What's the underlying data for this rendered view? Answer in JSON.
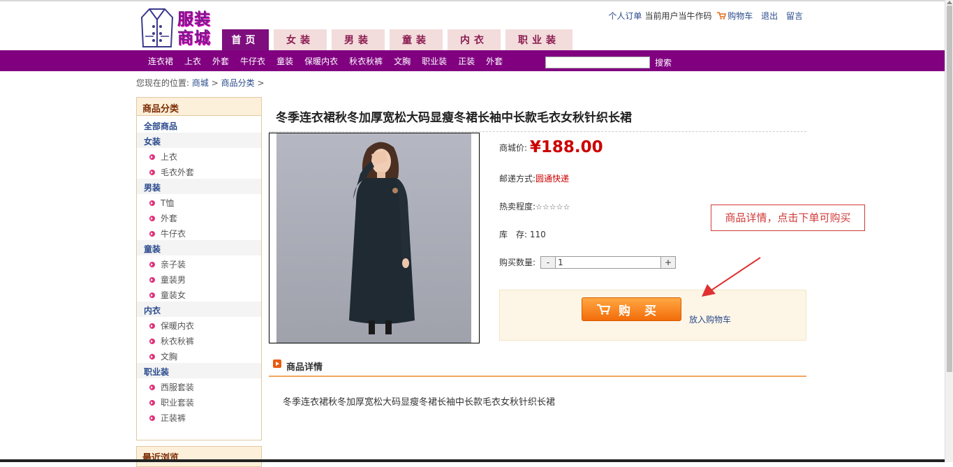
{
  "header": {
    "logo_text_line1": "服装",
    "logo_text_line2": "商城",
    "links": {
      "my_orders": "个人订单",
      "current_user_label": "当前用户",
      "current_user_name": "当牛作码",
      "cart": "购物车",
      "logout": "退出",
      "message": "留言"
    },
    "main_tabs": [
      {
        "label": "首页",
        "active": true
      },
      {
        "label": "女装",
        "active": false
      },
      {
        "label": "男装",
        "active": false
      },
      {
        "label": "童装",
        "active": false
      },
      {
        "label": "内衣",
        "active": false
      },
      {
        "label": "职业装",
        "active": false
      }
    ]
  },
  "navbar": {
    "items": [
      "连衣裙",
      "上衣",
      "外套",
      "牛仔衣",
      "童装",
      "保暖内衣",
      "秋衣秋裤",
      "文胸",
      "职业装",
      "正装",
      "外套"
    ],
    "search_value": "",
    "search_button": "搜索"
  },
  "breadcrumb": {
    "prefix": "您现在的位置:",
    "items": [
      "商城",
      "商品分类"
    ],
    "separator": ">"
  },
  "sidebar": {
    "title": "商品分类",
    "all": "全部商品",
    "categories": [
      {
        "name": "女装",
        "subs": [
          "上衣",
          "毛衣外套"
        ]
      },
      {
        "name": "男装",
        "subs": [
          "T恤",
          "外套",
          "牛仔衣"
        ]
      },
      {
        "name": "童装",
        "subs": [
          "亲子装",
          "童装男",
          "童装女"
        ]
      },
      {
        "name": "内衣",
        "subs": [
          "保暖内衣",
          "秋衣秋裤",
          "文胸"
        ]
      },
      {
        "name": "职业装",
        "subs": [
          "西服套装",
          "职业套装",
          "正装裤"
        ]
      }
    ],
    "recent_title": "最近浏览"
  },
  "product": {
    "title": "冬季连衣裙秋冬加厚宽松大码显瘦冬裙长袖中长款毛衣女秋针织长裙",
    "price_label": "商城价:",
    "price": "¥188.00",
    "shipping_label": "邮递方式:",
    "shipping_value": "圆通快递",
    "hot_label": "热卖程度:",
    "hot_stars": "☆☆☆☆☆",
    "stock_label": "库　存:",
    "stock_value": "110",
    "qty_label": "购买数量:",
    "qty_minus": "-",
    "qty_value": "1",
    "qty_plus": "+",
    "buy_button": "购买",
    "add_cart": "放入购物车"
  },
  "annotation": {
    "note": "商品详情，点击下单可购买",
    "color": "#d23a3a"
  },
  "detail": {
    "heading": "商品详情",
    "text": "冬季连衣裙秋冬加厚宽松大码显瘦冬裙长袖中长款毛衣女秋针织长裙"
  },
  "colors": {
    "nav_purple": "#800080",
    "price_red": "#cc0000",
    "buy_orange": "#f26c0a"
  }
}
